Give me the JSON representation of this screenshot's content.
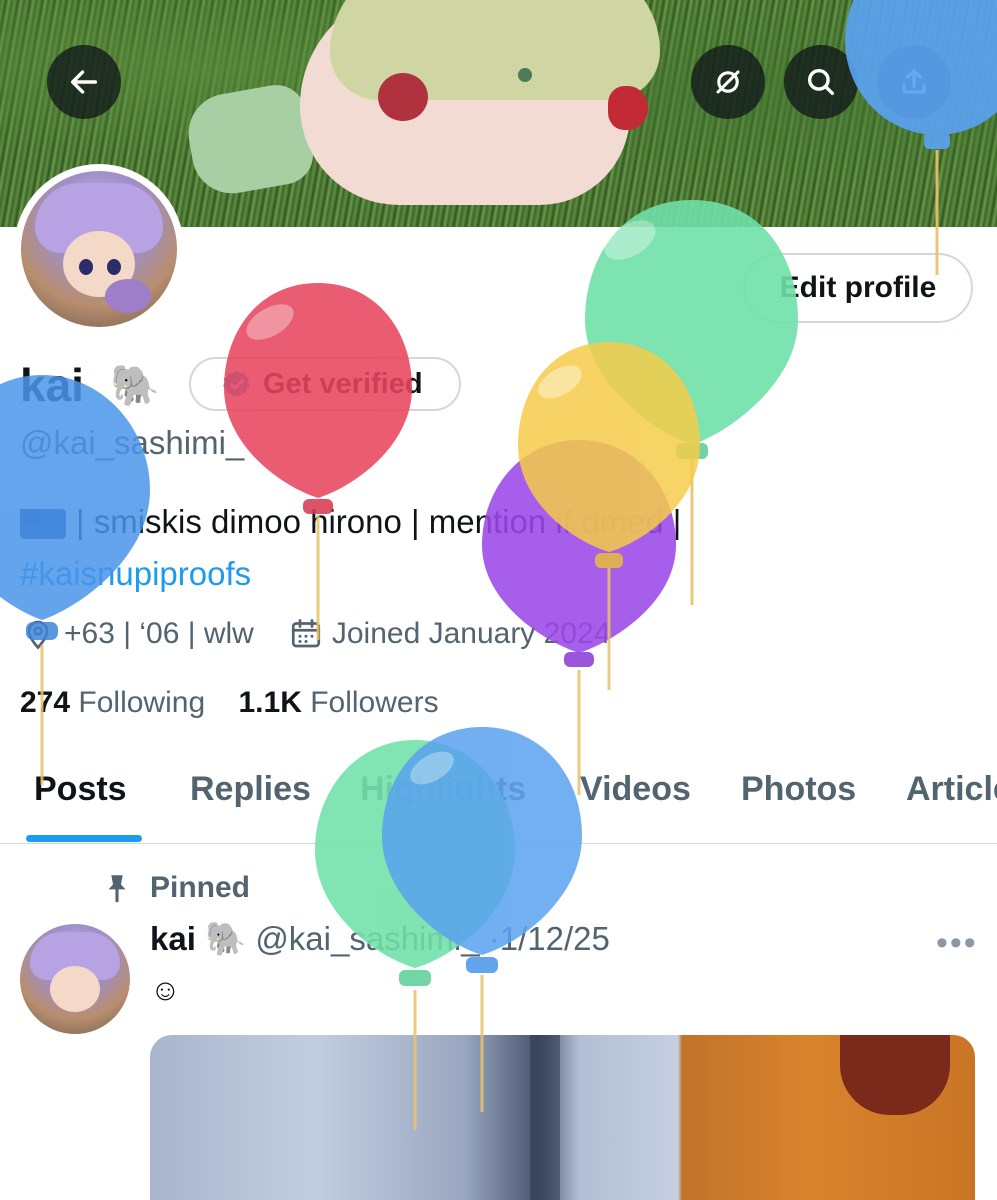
{
  "header": {
    "back_icon": "arrow-left-icon",
    "actions": [
      "link-off-icon",
      "search-icon",
      "share-icon"
    ]
  },
  "profile": {
    "name": "kai",
    "name_emoji": "🐘",
    "get_verified_label": "Get verified",
    "edit_profile_label": "Edit profile",
    "handle": "@kai_sashimi_",
    "bio_text": "| smiskis dimoo hirono | mention if dmed |",
    "bio_hashtag": "#kaisnupiproofs",
    "location_text": "+63 | ‘06 | wlw",
    "joined_text": "Joined January 2024",
    "following_count": "274",
    "following_label": "Following",
    "followers_count": "1.1K",
    "followers_label": "Followers"
  },
  "tabs": [
    {
      "label": "Posts",
      "active": true
    },
    {
      "label": "Replies",
      "active": false
    },
    {
      "label": "Highlights",
      "active": false
    },
    {
      "label": "Videos",
      "active": false
    },
    {
      "label": "Photos",
      "active": false
    },
    {
      "label": "Articles",
      "active": false
    }
  ],
  "pinned_post": {
    "pinned_label": "Pinned",
    "author_name": "kai",
    "author_emoji": "🐘",
    "author_handle": "@kai_sashimi_",
    "separator": "·",
    "date": "1/12/25",
    "text": "☺",
    "more_label": "•••"
  },
  "colors": {
    "accent": "#1d9bf0",
    "text_primary": "#0f1419",
    "text_secondary": "#536471",
    "border": "#cfd9de"
  }
}
